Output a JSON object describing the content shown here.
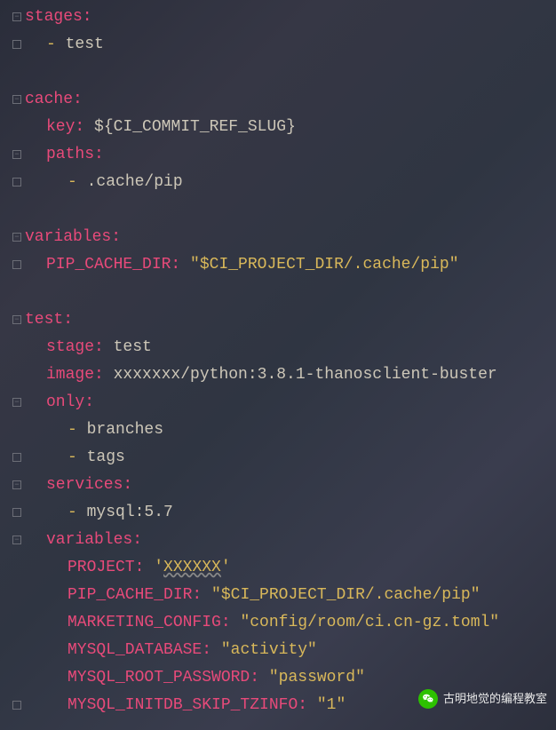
{
  "code": {
    "l1": {
      "k": "stages:"
    },
    "l2": {
      "d": "- ",
      "v": "test"
    },
    "l3": {
      "k": "cache:"
    },
    "l4": {
      "k": "key:",
      "sp": " ",
      "v": "${CI_COMMIT_REF_SLUG}"
    },
    "l5": {
      "k": "paths:"
    },
    "l6": {
      "d": "- ",
      "v": ".cache/pip"
    },
    "l7": {
      "k": "variables:"
    },
    "l8": {
      "k": "PIP_CACHE_DIR:",
      "sp": " ",
      "s": "\"$CI_PROJECT_DIR/.cache/pip\""
    },
    "l9": {
      "k": "test:"
    },
    "l10": {
      "k": "stage:",
      "sp": " ",
      "v": "test"
    },
    "l11": {
      "k": "image:",
      "sp": " ",
      "v": "xxxxxxx/python:3.8.1-thanosclient-buster"
    },
    "l12": {
      "k": "only:"
    },
    "l13": {
      "d": "- ",
      "v": "branches"
    },
    "l14": {
      "d": "- ",
      "v": "tags"
    },
    "l15": {
      "k": "services:"
    },
    "l16": {
      "d": "- ",
      "v": "mysql:5.7"
    },
    "l17": {
      "k": "variables:"
    },
    "l18": {
      "k": "PROJECT:",
      "sp": " ",
      "s1": "'",
      "u": "XXXXXX",
      "s2": "'"
    },
    "l19": {
      "k": "PIP_CACHE_DIR:",
      "sp": " ",
      "s": "\"$CI_PROJECT_DIR/.cache/pip\""
    },
    "l20": {
      "k": "MARKETING_CONFIG:",
      "sp": " ",
      "s": "\"config/room/ci.cn-gz.toml\""
    },
    "l21": {
      "k": "MYSQL_DATABASE:",
      "sp": " ",
      "s": "\"activity\""
    },
    "l22": {
      "k": "MYSQL_ROOT_PASSWORD:",
      "sp": " ",
      "s": "\"password\""
    },
    "l23": {
      "k": "MYSQL_INITDB_SKIP_TZINFO:",
      "sp": " ",
      "s": "\"1\""
    }
  },
  "watermark": {
    "text": "古明地觉的编程教室",
    "icon": "wechat-icon"
  }
}
